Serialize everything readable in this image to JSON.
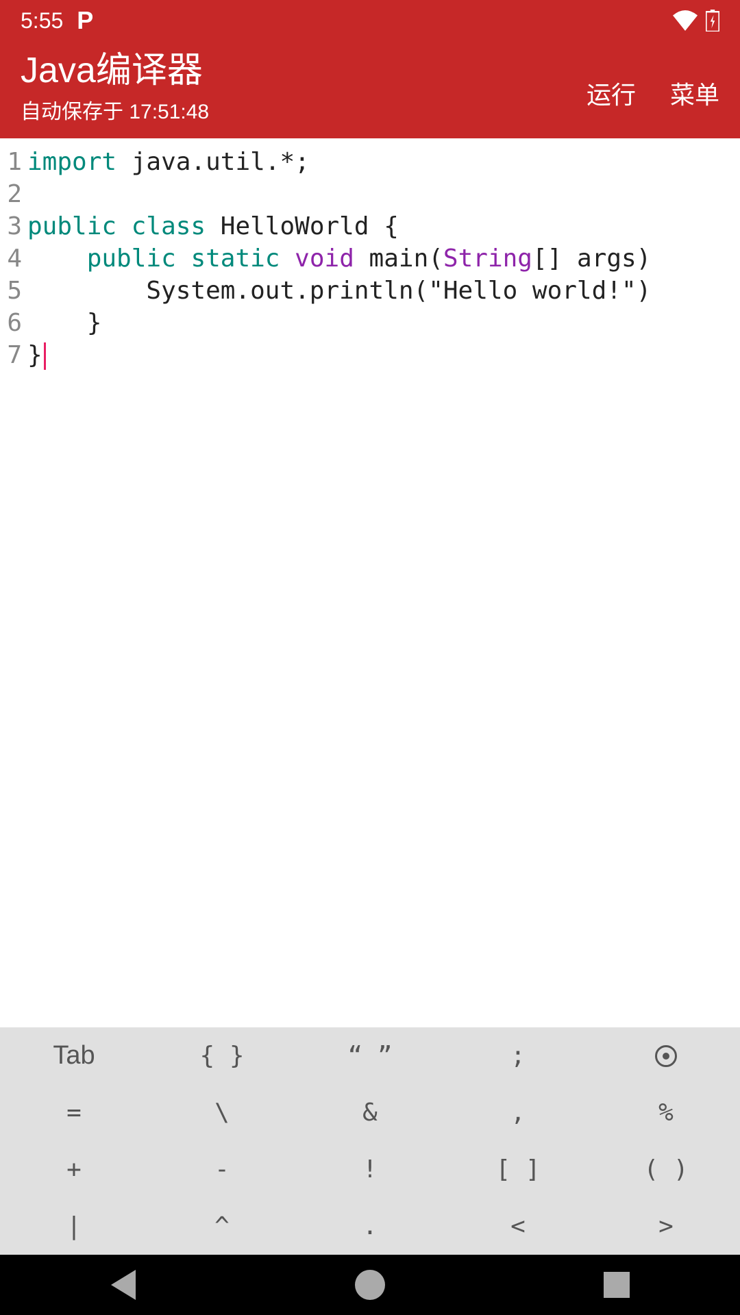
{
  "status_bar": {
    "time": "5:55",
    "app_letter": "P"
  },
  "app_bar": {
    "title": "Java编译器",
    "subtitle": "自动保存于 17:51:48",
    "run_label": "运行",
    "menu_label": "菜单"
  },
  "code": {
    "line_numbers": [
      "1",
      "2",
      "3",
      "4",
      "5",
      "6",
      "7"
    ],
    "lines": [
      {
        "tokens": [
          {
            "t": "import",
            "c": "kw"
          },
          {
            "t": " java.util.*;"
          }
        ]
      },
      {
        "tokens": []
      },
      {
        "tokens": [
          {
            "t": "public",
            "c": "kw"
          },
          {
            "t": " "
          },
          {
            "t": "class",
            "c": "kw"
          },
          {
            "t": " HelloWorld {"
          }
        ]
      },
      {
        "tokens": [
          {
            "t": "    "
          },
          {
            "t": "public",
            "c": "kw"
          },
          {
            "t": " "
          },
          {
            "t": "static",
            "c": "kw"
          },
          {
            "t": " "
          },
          {
            "t": "void",
            "c": "type"
          },
          {
            "t": " main("
          },
          {
            "t": "String",
            "c": "type"
          },
          {
            "t": "[] args)"
          }
        ]
      },
      {
        "tokens": [
          {
            "t": "        System.out.println(\"Hello world!\")"
          }
        ]
      },
      {
        "tokens": [
          {
            "t": "    }"
          }
        ]
      },
      {
        "tokens": [
          {
            "t": "}"
          }
        ],
        "cursor": true
      }
    ]
  },
  "symbols": {
    "row1": [
      "Tab",
      "{ }",
      "“ ”",
      ";",
      "⊙"
    ],
    "row2": [
      "=",
      "\\",
      "&",
      ",",
      "%"
    ],
    "row3": [
      "+",
      "-",
      "!",
      "[ ]",
      "( )"
    ],
    "row4": [
      "|",
      "^",
      ".",
      "<",
      ">"
    ]
  }
}
